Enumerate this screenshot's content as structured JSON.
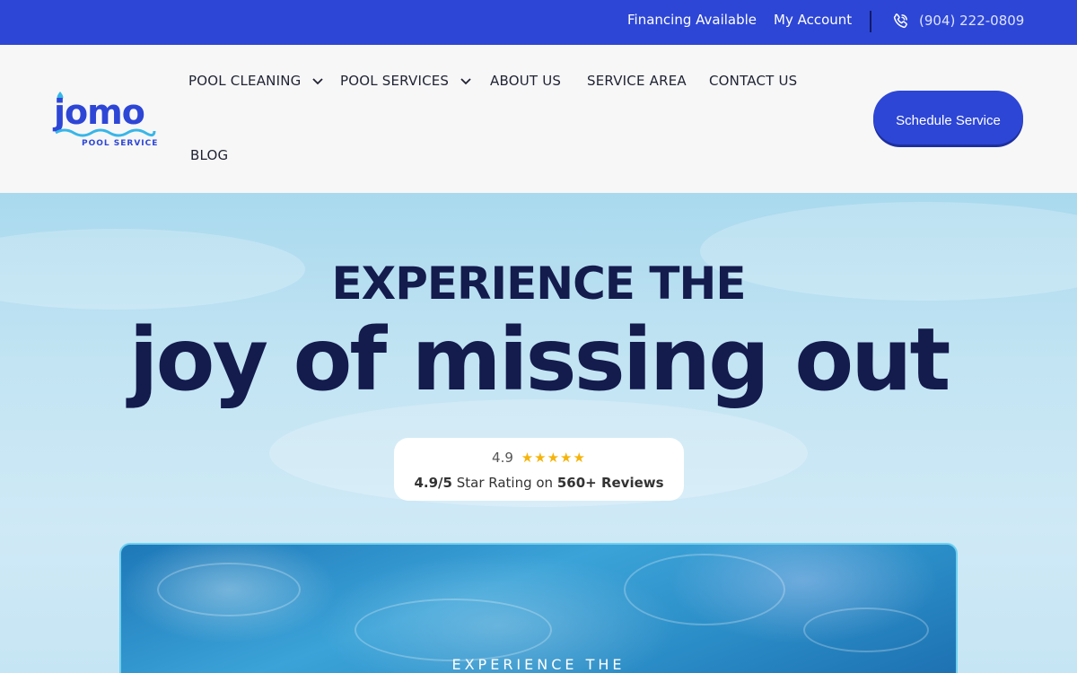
{
  "topbar": {
    "financing": "Financing Available",
    "account": "My Account",
    "phone": "(904) 222-0809"
  },
  "header": {
    "logo_text": "jomo",
    "logo_subtext": "POOL SERVICE",
    "nav": [
      {
        "label": "POOL CLEANING",
        "has_dropdown": true
      },
      {
        "label": "POOL SERVICES",
        "has_dropdown": true
      },
      {
        "label": "ABOUT US",
        "has_dropdown": false
      },
      {
        "label": "SERVICE AREA",
        "has_dropdown": false
      },
      {
        "label": "CONTACT US",
        "has_dropdown": false
      },
      {
        "label": "BLOG",
        "has_dropdown": false
      }
    ],
    "cta": "Schedule Service"
  },
  "hero": {
    "kicker": "EXPERIENCE THE",
    "headline": "joy of missing out",
    "rating": {
      "score": "4.9",
      "stars": 5,
      "rating_value": "4.9/5",
      "rating_text": "Star Rating on",
      "reviews": "560+ Reviews"
    },
    "video_caption": "EXPERIENCE THE"
  },
  "colors": {
    "brand_blue": "#2d46d6",
    "navy": "#141b4d",
    "star": "#f5b40b"
  }
}
